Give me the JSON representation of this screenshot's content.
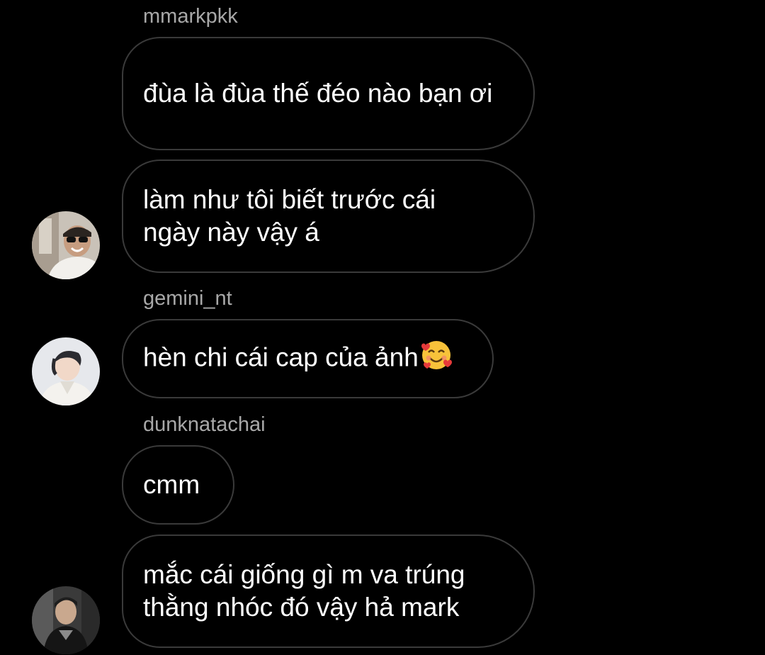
{
  "messages": [
    {
      "sender": "mmarkpkk",
      "text": "đùa là đùa thế đéo nào bạn ơi"
    },
    {
      "text": "làm như tôi biết trước cái ngày này vậy á"
    },
    {
      "sender": "gemini_nt",
      "text": "hèn chi cái cap của ảnh",
      "emoji": "smiling-face-with-hearts-emoji"
    },
    {
      "sender": "dunknatachai",
      "text": "cmm"
    },
    {
      "text": "mắc cái giống gì m va trúng thằng nhóc đó vậy hả mark"
    }
  ],
  "colors": {
    "background": "#000000",
    "bubble_border": "#3a3a3a",
    "text": "#ffffff",
    "sender_name": "#a8a8a8"
  }
}
